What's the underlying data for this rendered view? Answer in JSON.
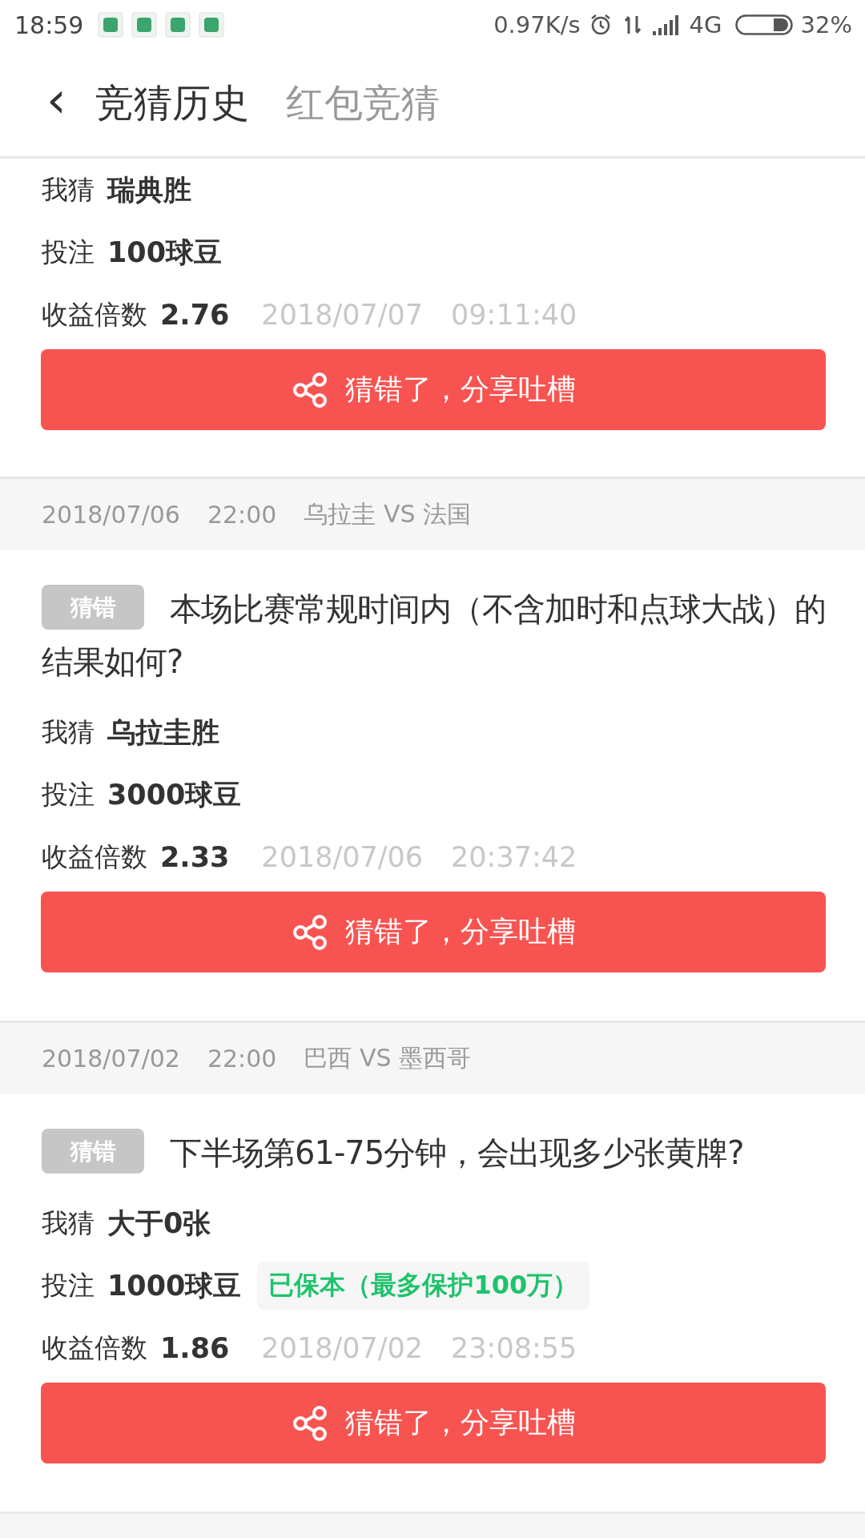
{
  "status_bar": {
    "time": "18:59",
    "net_speed": "0.97K/s",
    "network": "4G",
    "battery": "32%"
  },
  "header": {
    "back": "‹",
    "tabs": [
      {
        "label": "竞猜历史",
        "selected": true
      },
      {
        "label": "红包竞猜",
        "selected": false
      }
    ]
  },
  "records": [
    {
      "guess_label": "我猜",
      "guess": "瑞典胜",
      "stake_label": "投注",
      "stake": "100球豆",
      "odds_label": "收益倍数",
      "odds": "2.76",
      "time": "2018/07/07　09:11:40",
      "button": "猜错了，分享吐槽"
    },
    {
      "match_date": "2018/07/06",
      "match_time": "22:00",
      "match": "乌拉圭 VS 法国",
      "tag": "猜错",
      "question": "本场比赛常规时间内（不含加时和点球大战）的结果如何?",
      "guess_label": "我猜",
      "guess": "乌拉圭胜",
      "stake_label": "投注",
      "stake": "3000球豆",
      "odds_label": "收益倍数",
      "odds": "2.33",
      "time": "2018/07/06　20:37:42",
      "button": "猜错了，分享吐槽"
    },
    {
      "match_date": "2018/07/02",
      "match_time": "22:00",
      "match": "巴西 VS 墨西哥",
      "tag": "猜错",
      "question": "下半场第61-75分钟，会出现多少张黄牌?",
      "guess_label": "我猜",
      "guess": "大于0张",
      "stake_label": "投注",
      "stake": "1000球豆",
      "protection": "已保本（最多保护100万）",
      "odds_label": "收益倍数",
      "odds": "1.86",
      "time": "2018/07/02　23:08:55",
      "button": "猜错了，分享吐槽"
    }
  ]
}
